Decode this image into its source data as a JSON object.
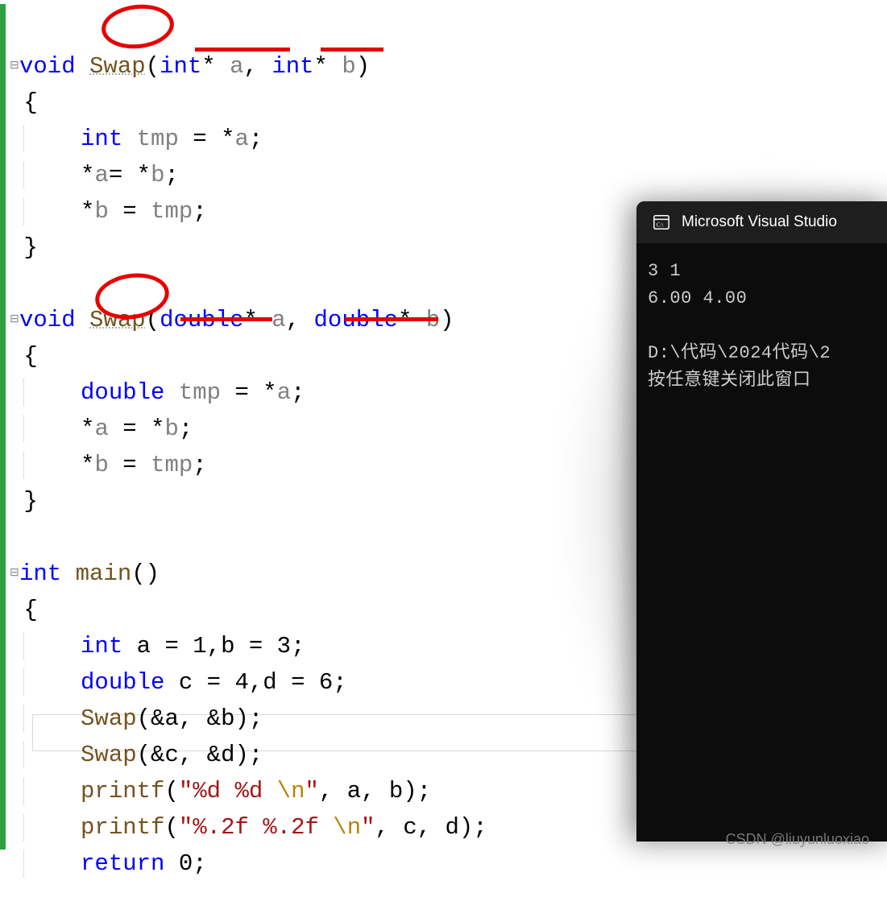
{
  "code": {
    "fn1": {
      "kw_void": "void",
      "name": "Swap",
      "p1_type": "int",
      "p1_star": "*",
      "p1_name": "a",
      "comma": ", ",
      "p2_type": "int",
      "p2_star": "*",
      "p2_name": "b",
      "ln_decl_type": "int",
      "ln_decl_var": "tmp",
      "ln_decl_eq": " = *",
      "ln_decl_a": "a",
      "ln2": "*a= *b;",
      "ln3_star": "*",
      "ln3_b": "b",
      "ln3_eq": " = ",
      "ln3_tmp": "tmp",
      "semi": ";"
    },
    "fn2": {
      "kw_void": "void",
      "name": "Swap",
      "p1_type": "double",
      "p1_star": "*",
      "p1_name": "a",
      "comma": ", ",
      "p2_type": "double",
      "p2_star": "*",
      "p2_name": "b",
      "ln_decl_type": "double",
      "ln_decl_var": "tmp",
      "ln_decl_eq": " = *",
      "ln_decl_a": "a",
      "ln2": "*a = *b;",
      "ln3_star": "*",
      "ln3_b": "b",
      "ln3_eq": " = ",
      "ln3_tmp": "tmp",
      "semi": ";"
    },
    "main": {
      "kw_int": "int",
      "name": "main",
      "l1_type": "int",
      "l1_rest": " a = 1,b = 3;",
      "l2_type": "double",
      "l2_rest": " c = 4,d = 6;",
      "l3_fn": "Swap",
      "l3_rest": "(&a, &b);",
      "l4_fn": "Swap",
      "l4_rest": "(&c, &d);",
      "l5_fn": "printf",
      "l5_p1": "(",
      "l5_str": "\"%d %d ",
      "l5_esc": "\\n",
      "l5_strend": "\"",
      "l5_rest": ", a, b);",
      "l6_fn": "printf",
      "l6_p1": "(",
      "l6_str": "\"%.2f %.2f ",
      "l6_esc": "\\n",
      "l6_strend": "\"",
      "l6_rest": ", c, d);",
      "l7_kw": "return",
      "l7_rest": " 0;"
    },
    "brace_open": "{",
    "brace_close": "}",
    "paren_open": "(",
    "paren_close": ")"
  },
  "terminal": {
    "title": "Microsoft Visual Studio",
    "out_line1": "3 1",
    "out_line2": "6.00 4.00",
    "path_line": "D:\\代码\\2024代码\\2",
    "prompt_line": "按任意键关闭此窗口"
  },
  "watermark": "CSDN @liuyunluoxiao"
}
